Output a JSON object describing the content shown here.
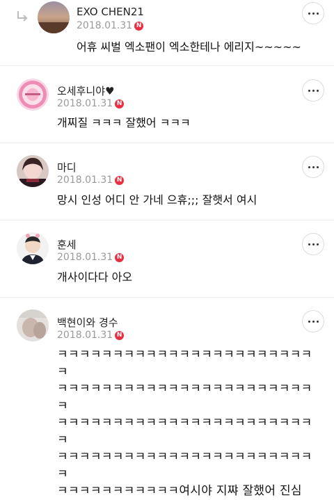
{
  "comments": [
    {
      "username": "EXO CHEN21",
      "date": "2018.01.31",
      "badge": "N",
      "text": "어휴 씨벌 엑소팬이 엑소한테나 에리지~~~~~",
      "is_reply": true
    },
    {
      "username": "오세후니야♥",
      "date": "2018.01.31",
      "badge": "N",
      "text": "개찌질 ㅋㅋㅋ 잘했어 ㅋㅋㅋ"
    },
    {
      "username": "마디",
      "date": "2018.01.31",
      "badge": "N",
      "text": "망시 인성 어디 안 가네 으휴;;; 잘햇서 여시"
    },
    {
      "username": "훈세",
      "date": "2018.01.31",
      "badge": "N",
      "text": "개사이다다 아오"
    },
    {
      "username": "백현이와 경수",
      "date": "2018.01.31",
      "badge": "N",
      "text_lines": [
        "ㅋㅋㅋㅋㅋㅋㅋㅋㅋㅋㅋㅋㅋㅋㅋㅋㅋㅋㅋㅋㅋㅋㅋㅋ",
        "ㅋㅋㅋㅋㅋㅋㅋㅋㅋㅋㅋㅋㅋㅋㅋㅋㅋㅋㅋㅋㅋㅋㅋㅋ",
        "ㅋㅋㅋㅋㅋㅋㅋㅋㅋㅋㅋㅋㅋㅋㅋㅋㅋㅋㅋㅋㅋㅋㅋㅋ",
        "ㅋㅋㅋㅋㅋㅋㅋㅋㅋㅋㅋㅋㅋㅋㅋㅋㅋㅋㅋㅋㅋㅋㅋㅋ",
        "ㅋㅋㅋㅋㅋㅋㅋㅋㅋㅋㅋ여시야 지쨔 잘했어 진심"
      ]
    }
  ],
  "colors": {
    "badge": "#ea2f43",
    "date": "#9a9a9a",
    "divider": "#ececec"
  },
  "icons": {
    "reply": "reply-arrow-icon",
    "more": "more-options-icon",
    "new_badge": "new-badge-icon"
  }
}
